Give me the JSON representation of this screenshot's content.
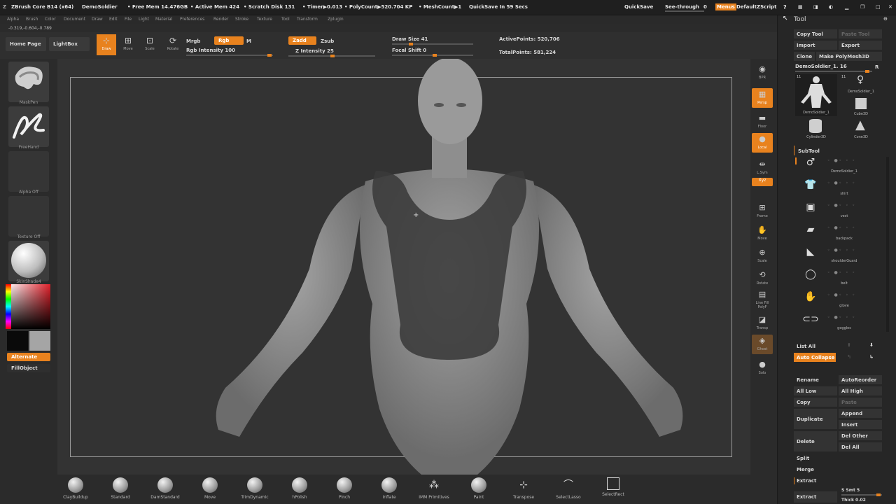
{
  "titlebar": {
    "app": "ZBrush Core B14 (x64)",
    "doc": "DemoSoldier",
    "free_mem": "• Free Mem 14.476GB",
    "active_mem": "• Active Mem 424",
    "scratch": "• Scratch Disk 131",
    "timer": "• Timer▶0.013",
    "polycount": "• PolyCount▶520.704 KP",
    "meshcount": "• MeshCount▶1",
    "quicksave_timer": "QuickSave In 59 Secs",
    "quicksave": "QuickSave",
    "see_through": "See-through",
    "see_through_val": "0",
    "menus": "Menus",
    "zscript": "DefaultZScript"
  },
  "menu": [
    "Alpha",
    "Brush",
    "Color",
    "Document",
    "Draw",
    "Edit",
    "File",
    "Light",
    "Material",
    "Preferences",
    "Render",
    "Stroke",
    "Texture",
    "Tool",
    "Transform",
    "Zplugin"
  ],
  "coords": "-0.319,-0.604,-0.789",
  "shelf": {
    "home": "Home Page",
    "lightbox": "LightBox",
    "draw": "Draw",
    "move": "Move",
    "scale": "Scale",
    "rotate": "Rotate",
    "mrgb": "Mrgb",
    "rgb": "Rgb",
    "m": "M",
    "rgb_intensity": "Rgb Intensity 100",
    "zadd": "Zadd",
    "zsub": "Zsub",
    "z_intensity": "Z Intensity 25",
    "draw_size": "Draw Size 41",
    "focal_shift": "Focal Shift 0",
    "active_points": "ActivePoints: 520,706",
    "total_points": "TotalPoints: 581,224"
  },
  "left": {
    "brush1": "MaskPen",
    "brush2": "FreeHand",
    "alpha": "Alpha Off",
    "texture": "Texture Off",
    "material": "SkinShade4",
    "alternate": "Alternate",
    "fillobject": "FillObject"
  },
  "vtool": [
    "BPR",
    "Persp",
    "Floor",
    "Local",
    "L.Sym",
    "Xyz",
    "Frame",
    "Move",
    "Scale",
    "Rotate",
    "Line Fill PolyF",
    "Transp",
    "Ghost",
    "Solo"
  ],
  "tool": {
    "title": "Tool",
    "copy_tool": "Copy Tool",
    "paste_tool": "Paste Tool",
    "import": "Import",
    "export": "Export",
    "clone": "Clone",
    "make_polymesh": "Make PolyMesh3D",
    "current_tool": "DemoSoldier_1. 16",
    "r": "R",
    "thumb_count1": "11",
    "thumb_count2": "11",
    "tools": [
      "DemoSoldier_1",
      "DemoSoldier_1",
      "Cube3D",
      "Cylinder3D",
      "Cone3D"
    ],
    "subtool_header": "SubTool",
    "subtools": [
      "DemoSoldier_1",
      "shirt",
      "vest",
      "backpack",
      "shoulderGuard",
      "belt",
      "glove",
      "goggles"
    ],
    "list_all": "List All",
    "auto_collapse": "Auto Collapse",
    "rename": "Rename",
    "auto_reorder": "AutoReorder",
    "all_low": "All Low",
    "all_high": "All High",
    "copy": "Copy",
    "paste": "Paste",
    "duplicate": "Duplicate",
    "append": "Append",
    "insert": "Insert",
    "delete": "Delete",
    "del_other": "Del Other",
    "del_all": "Del All",
    "split": "Split",
    "merge": "Merge",
    "extract_header": "Extract",
    "extract": "Extract",
    "s_smt": "S Smt 5",
    "thick": "Thick 0.02"
  },
  "brushes": [
    "ClayBuildup",
    "Standard",
    "DamStandard",
    "Move",
    "TrimDynamic",
    "hPolish",
    "Pinch",
    "Inflate",
    "IMM Primitives",
    "Paint",
    "Transpose",
    "SelectLasso",
    "SelectRect"
  ],
  "colors": {
    "accent": "#e8821e",
    "bg": "#2b2b2b",
    "mask": "#3a3a3a"
  }
}
